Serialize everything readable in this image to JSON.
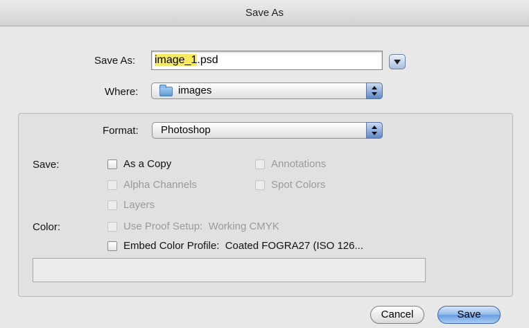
{
  "window": {
    "title": "Save As"
  },
  "save_as": {
    "label": "Save As:",
    "filename_selected": "image_1",
    "filename_extension": ".psd"
  },
  "where": {
    "label": "Where:",
    "value": "images"
  },
  "format": {
    "label": "Format:",
    "value": "Photoshop"
  },
  "save_options": {
    "label": "Save:",
    "as_a_copy": "As a Copy",
    "annotations": "Annotations",
    "alpha_channels": "Alpha Channels",
    "spot_colors": "Spot Colors",
    "layers": "Layers"
  },
  "color_options": {
    "label": "Color:",
    "use_proof_setup": "Use Proof Setup:  Working CMYK",
    "embed_color_profile": "Embed Color Profile:  Coated FOGRA27 (ISO 126..."
  },
  "buttons": {
    "cancel": "Cancel",
    "save": "Save"
  }
}
